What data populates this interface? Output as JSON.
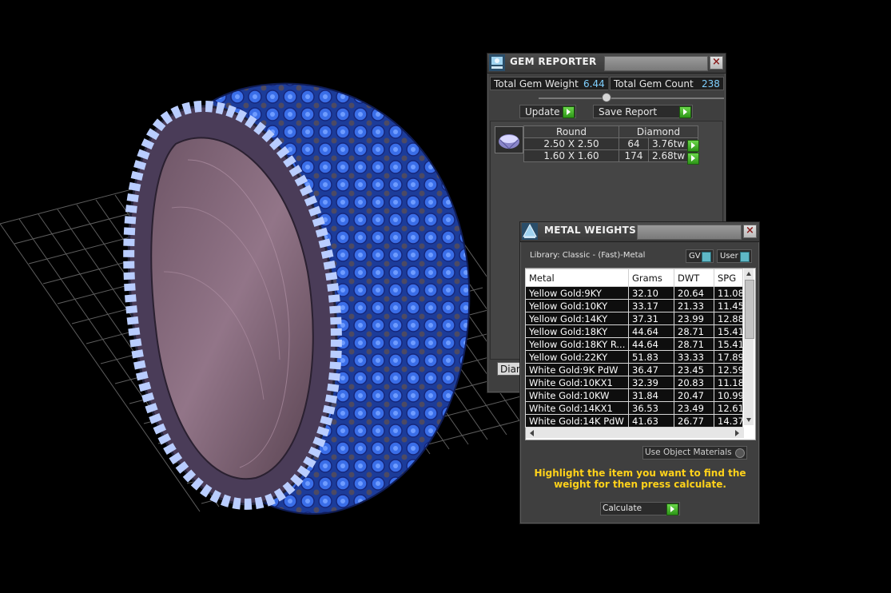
{
  "gem_reporter": {
    "title": "GEM REPORTER",
    "total_gem_weight_label": "Total Gem Weight",
    "total_gem_weight_value": "6.44",
    "total_gem_count_label": "Total Gem Count",
    "total_gem_count_value": "238",
    "update_label": "Update",
    "save_report_label": "Save Report",
    "shape_header": "Round",
    "material_header": "Diamond",
    "rows": [
      {
        "size": "2.50 X 2.50",
        "count": "64",
        "weight": "3.76tw"
      },
      {
        "size": "1.60 X 1.60",
        "count": "174",
        "weight": "2.68tw"
      }
    ],
    "tab_partial": "Diam"
  },
  "metal_weights": {
    "title": "METAL WEIGHTS",
    "library_label": "Library: Classic - (Fast)-Metal",
    "gv_label": "GV",
    "user_label": "User",
    "columns": [
      "Metal",
      "Grams",
      "DWT",
      "SPG"
    ],
    "rows": [
      {
        "metal": "Yellow Gold:9KY",
        "grams": "32.10",
        "dwt": "20.64",
        "spg": "11.08"
      },
      {
        "metal": "Yellow Gold:10KY",
        "grams": "33.17",
        "dwt": "21.33",
        "spg": "11.45"
      },
      {
        "metal": "Yellow Gold:14KY",
        "grams": "37.31",
        "dwt": "23.99",
        "spg": "12.88"
      },
      {
        "metal": "Yellow Gold:18KY",
        "grams": "44.64",
        "dwt": "28.71",
        "spg": "15.41"
      },
      {
        "metal": "Yellow Gold:18KY R...",
        "grams": "44.64",
        "dwt": "28.71",
        "spg": "15.41"
      },
      {
        "metal": "Yellow Gold:22KY",
        "grams": "51.83",
        "dwt": "33.33",
        "spg": "17.89"
      },
      {
        "metal": "White Gold:9K PdW",
        "grams": "36.47",
        "dwt": "23.45",
        "spg": "12.59"
      },
      {
        "metal": "White Gold:10KX1",
        "grams": "32.39",
        "dwt": "20.83",
        "spg": "11.18"
      },
      {
        "metal": "White Gold:10KW",
        "grams": "31.84",
        "dwt": "20.47",
        "spg": "10.99"
      },
      {
        "metal": "White Gold:14KX1",
        "grams": "36.53",
        "dwt": "23.49",
        "spg": "12.61"
      },
      {
        "metal": "White Gold:14K PdW",
        "grams": "41.63",
        "dwt": "26.77",
        "spg": "14.37"
      }
    ],
    "use_object_materials_label": "Use Object Materials",
    "hint": "Highlight the item you want to find the weight for then press calculate.",
    "calculate_label": "Calculate"
  },
  "colors": {
    "accent_number": "#7fd0ff",
    "go_arrow": "#3fb21f",
    "hint_text": "#ffd21a"
  }
}
